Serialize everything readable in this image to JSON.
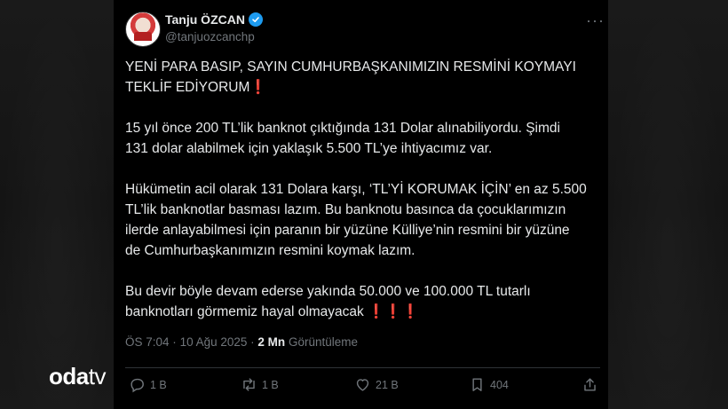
{
  "tweet": {
    "author_name": "Tanju ÖZCAN",
    "handle": "@tanjuozcanchp",
    "paragraphs": [
      "YENİ PARA BASIP, SAYIN CUMHURBAŞKANIMIZIN RESMİNİ KOYMAYI TEKLİF EDİYORUM",
      "15 yıl önce 200 TL’lik banknot çıktığında 131 Dolar alınabiliyordu. Şimdi 131 dolar alabilmek için yaklaşık 5.500 TL’ye ihtiyacımız var.",
      "Hükümetin acil olarak 131 Dolara karşı, ‘TL’Yİ KORUMAK İÇİN’ en az 5.500 TL’lik banknotlar basması lazım. Bu banknotu basınca da çocuklarımızın ilerde anlayabilmesi için paranın bir yüzüne Külliye’nin resmini bir yüzüne de Cumhurbaşkanımızın resmini koymak lazım.",
      "Bu devir böyle devam ederse yakında 50.000 ve 100.000 TL tutarlı banknotları görmemiz hayal olmayacak"
    ],
    "exclaim_1": "❗",
    "exclaim_3": "❗❗❗",
    "time": "ÖS 7:04",
    "dot": "·",
    "date": "10 Ağu 2025",
    "views_count": "2 Mn",
    "views_label": "Görüntüleme",
    "more_label": "···",
    "actions": {
      "replies": "1 B",
      "reposts": "1 B",
      "likes": "21 B",
      "bookmarks": "404"
    }
  },
  "watermark": {
    "brand_main": "oda",
    "brand_tv": "tv"
  },
  "colors": {
    "verified": "#1d9bf0",
    "exclaim": "#e0202f",
    "muted": "#71767b"
  }
}
